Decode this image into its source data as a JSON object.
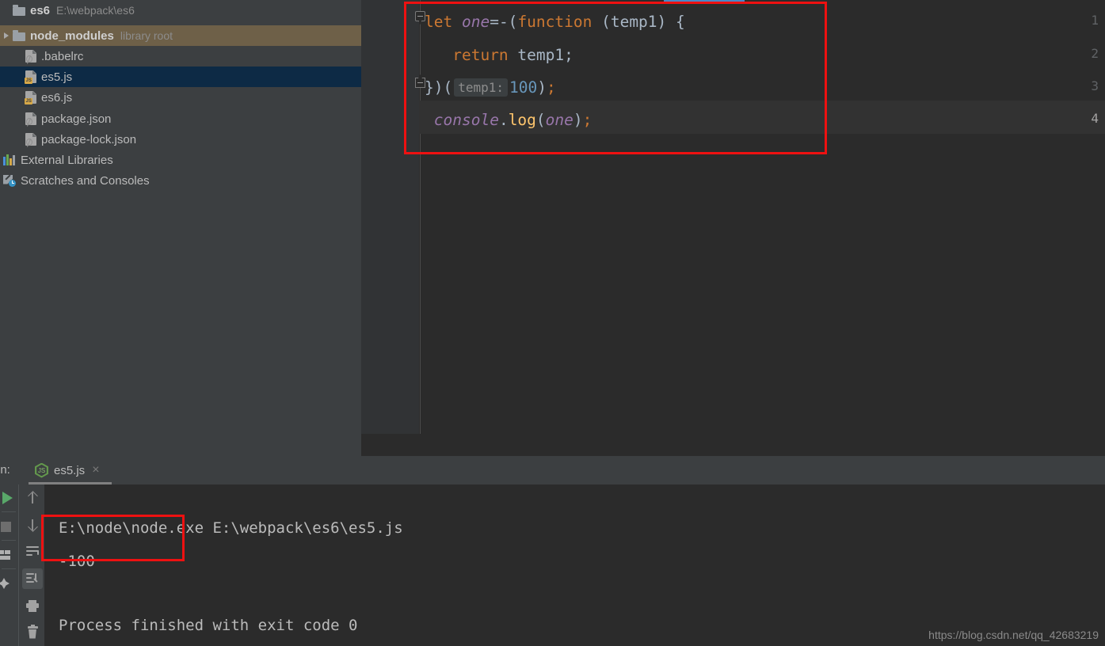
{
  "project": {
    "root": {
      "name": "es6",
      "path": "E:\\webpack\\es6",
      "icon": "folder-icon"
    },
    "items": [
      {
        "name": "node_modules",
        "tag": "library root",
        "icon": "folder-icon",
        "state": "excluded",
        "expandable": true,
        "indent": 0
      },
      {
        "name": ".babelrc",
        "tag": "",
        "icon": "json-file-icon",
        "state": "normal",
        "expandable": false,
        "indent": 1
      },
      {
        "name": "es5.js",
        "tag": "",
        "icon": "js-file-icon",
        "state": "selected",
        "expandable": false,
        "indent": 1
      },
      {
        "name": "es6.js",
        "tag": "",
        "icon": "js-file-icon",
        "state": "normal",
        "expandable": false,
        "indent": 1
      },
      {
        "name": "package.json",
        "tag": "",
        "icon": "json-file-icon",
        "state": "normal",
        "expandable": false,
        "indent": 1
      },
      {
        "name": "package-lock.json",
        "tag": "",
        "icon": "json-file-icon",
        "state": "normal",
        "expandable": false,
        "indent": 1
      },
      {
        "name": "External Libraries",
        "tag": "",
        "icon": "libraries-icon",
        "state": "normal",
        "expandable": false,
        "indent": 0
      },
      {
        "name": "Scratches and Consoles",
        "tag": "",
        "icon": "scratches-icon",
        "state": "normal",
        "expandable": false,
        "indent": 0
      }
    ]
  },
  "editor": {
    "line_numbers": [
      "1",
      "2",
      "3",
      "4"
    ],
    "current_line": "4",
    "lines": [
      {
        "n": "1",
        "tokens": [
          {
            "t": "let ",
            "c": "kw"
          },
          {
            "t": "one",
            "c": "var"
          },
          {
            "t": "=-(",
            "c": "plain"
          },
          {
            "t": "function",
            "c": "kw"
          },
          {
            "t": " (temp1) {",
            "c": "plain"
          }
        ]
      },
      {
        "n": "2",
        "tokens": [
          {
            "t": "   ",
            "c": "plain"
          },
          {
            "t": "return",
            "c": "kw"
          },
          {
            "t": " temp1;",
            "c": "plain"
          }
        ]
      },
      {
        "n": "3",
        "tokens": [
          {
            "t": "})(",
            "c": "plain"
          },
          {
            "t": "temp1:",
            "c": "inlay"
          },
          {
            "t": "100",
            "c": "num"
          },
          {
            "t": ")",
            "c": "plain"
          },
          {
            "t": ";",
            "c": "kw"
          }
        ]
      },
      {
        "n": "4",
        "tokens": [
          {
            "t": " ",
            "c": "plain"
          },
          {
            "t": "console",
            "c": "var"
          },
          {
            "t": ".",
            "c": "plain"
          },
          {
            "t": "log",
            "c": "fn"
          },
          {
            "t": "(",
            "c": "plain"
          },
          {
            "t": "one",
            "c": "var"
          },
          {
            "t": ")",
            "c": "plain"
          },
          {
            "t": ";",
            "c": "kw"
          }
        ]
      }
    ],
    "annotation_color": "#ee1111"
  },
  "run_panel": {
    "label": "un:",
    "tab": {
      "title": "es5.js",
      "icon": "nodejs-icon",
      "close": "×"
    },
    "console": {
      "command": "E:\\node\\node.exe E:\\webpack\\es6\\es5.js",
      "output": "-100",
      "status": "Process finished with exit code 0"
    },
    "left_strip_icons": [
      "run-icon",
      "stop-icon",
      "layout-icon",
      "pin-icon"
    ],
    "toolbar_icons": [
      "arrow-up-icon",
      "arrow-down-icon",
      "soft-wrap-icon",
      "scroll-to-end-icon",
      "print-icon",
      "trash-icon"
    ],
    "active_toolbar_icon": "scroll-to-end-icon"
  },
  "watermark": "https://blog.csdn.net/qq_42683219",
  "colors": {
    "panel_bg": "#3c3f41",
    "editor_bg": "#2b2b2b",
    "gutter_bg": "#313335",
    "selection_bg": "#0d2a45",
    "excluded_bg": "#6e6048",
    "tab_accent": "#4a88c7",
    "keyword": "#cc7832",
    "variable": "#9876aa",
    "number": "#6897bb",
    "function": "#ffc66d",
    "plain": "#a9b7c6",
    "annotation": "#ee1111"
  }
}
